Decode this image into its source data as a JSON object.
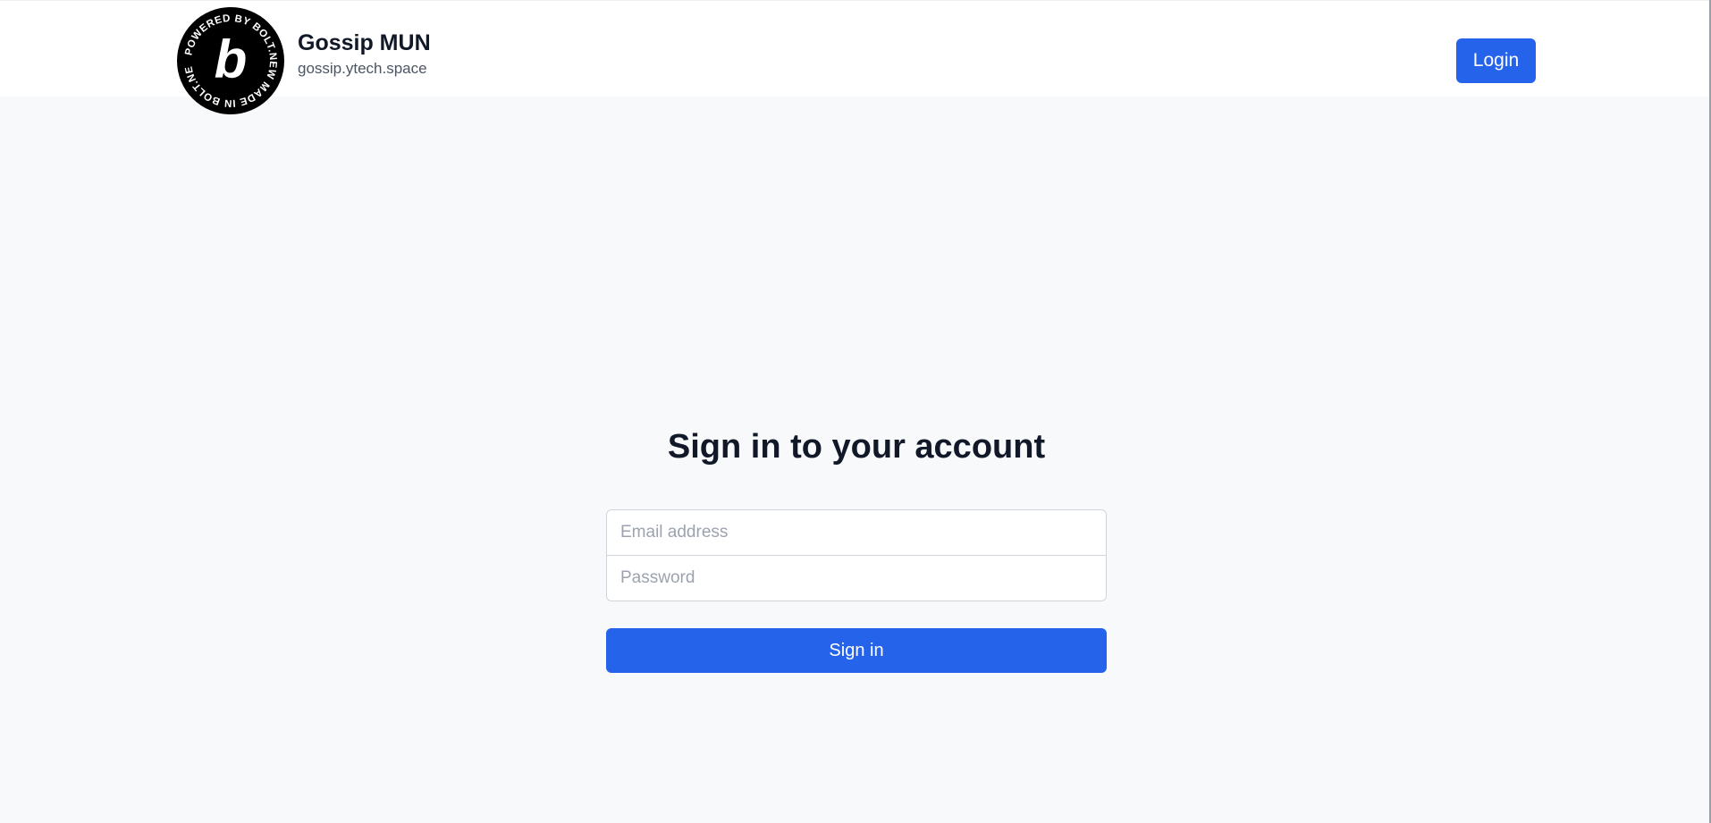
{
  "header": {
    "badge_text": "POWERED BY BOLT.NEW MADE IN BOLT.NEW",
    "badge_letter": "b",
    "site_title": "Gossip MUN",
    "site_subtitle": "gossip.ytech.space",
    "login_label": "Login"
  },
  "signin": {
    "heading": "Sign in to your account",
    "email_placeholder": "Email address",
    "password_placeholder": "Password",
    "submit_label": "Sign in"
  },
  "colors": {
    "accent": "#2563eb",
    "page_bg": "#f8f9fb",
    "header_bg": "#ffffff",
    "text_dark": "#111827"
  }
}
